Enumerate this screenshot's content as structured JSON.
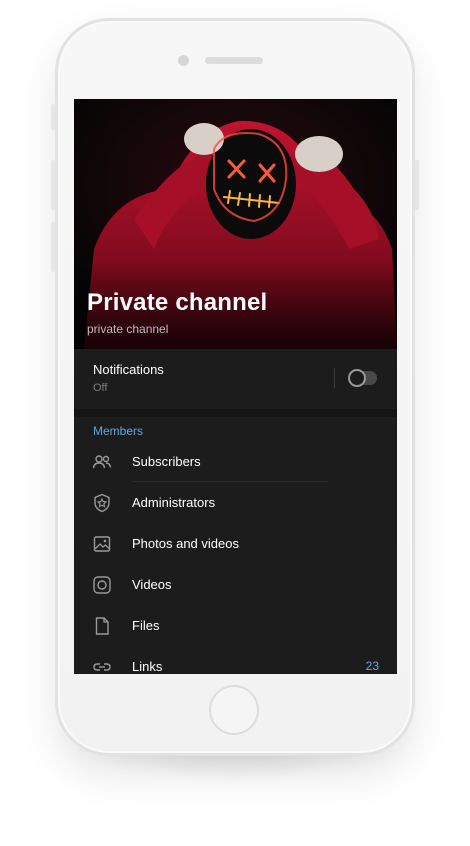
{
  "channel": {
    "title": "Private channel",
    "subtitle": "private channel"
  },
  "notifications": {
    "label": "Notifications",
    "value": "Off",
    "enabled": false
  },
  "members_section": {
    "header": "Members",
    "items": [
      {
        "label": "Subscribers",
        "icon": "people-icon"
      },
      {
        "label": "Administrators",
        "icon": "shield-star-icon"
      },
      {
        "label": "Photos and videos",
        "icon": "image-icon"
      },
      {
        "label": "Videos",
        "icon": "video-circle-icon"
      },
      {
        "label": "Files",
        "icon": "file-icon"
      },
      {
        "label": "Links",
        "icon": "link-icon",
        "count": "23"
      }
    ]
  },
  "colors": {
    "accent": "#5ea7e8",
    "screen_bg": "#1c1c1d",
    "hoodie": "#b3102a"
  }
}
